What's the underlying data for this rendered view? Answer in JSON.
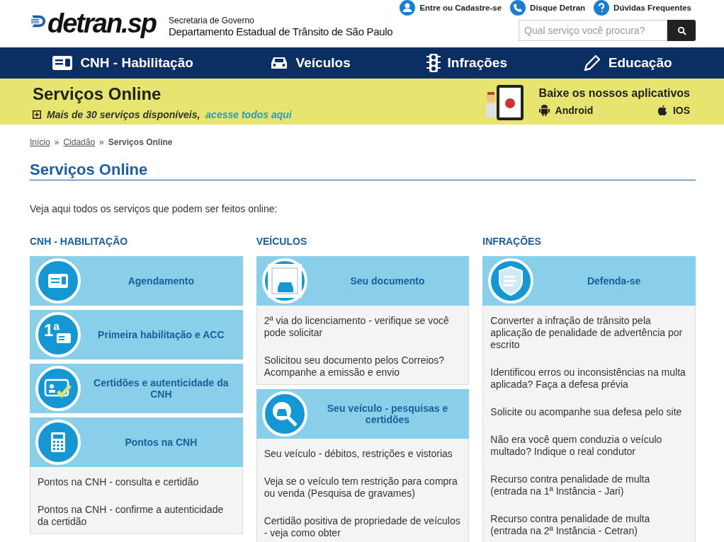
{
  "header": {
    "logo_text": "detran.sp",
    "org_line1": "Secretaria de Governo",
    "org_line2": "Departamento Estadual de Trânsito de São Paulo",
    "top_links": [
      {
        "kind": "user",
        "label": "Entre ou Cadastre-se"
      },
      {
        "kind": "phone",
        "label": "Disque Detran"
      },
      {
        "kind": "help",
        "label": "Dúvidas Frequentes"
      }
    ],
    "search": {
      "placeholder": "Qual serviço você procura?"
    }
  },
  "nav": [
    {
      "kind": "license",
      "label": "CNH - Habilitação"
    },
    {
      "kind": "car",
      "label": "Veículos"
    },
    {
      "kind": "traffic-light",
      "label": "Infrações"
    },
    {
      "kind": "pencil",
      "label": "Educação"
    }
  ],
  "banner": {
    "title": "Serviços Online",
    "lead": "Mais de 30 serviços disponíveis,",
    "link": "acesse todos aqui",
    "apps_title": "Baixe os nossos aplicativos",
    "apps": [
      {
        "kind": "android",
        "label": "Android"
      },
      {
        "kind": "apple",
        "label": "IOS"
      }
    ]
  },
  "breadcrumb": [
    {
      "label": "Início",
      "current": false
    },
    {
      "label": "Cidadão",
      "current": false
    },
    {
      "label": "Serviços Online",
      "current": true
    }
  ],
  "breadcrumb_separator": "»",
  "page_title": "Serviços Online",
  "intro": "Veja aqui todos os serviços que podem ser feitos online:",
  "columns": [
    {
      "heading": "CNH - HABILITAÇÃO",
      "cards": [
        {
          "kind": "license",
          "title": "Agendamento"
        },
        {
          "kind": "first",
          "title": "Primeira habilitação e ACC",
          "badge": "1ª"
        },
        {
          "kind": "certificate",
          "title": "Certidões e autenticidade da CNH"
        },
        {
          "kind": "calculator",
          "title": "Pontos na CNH",
          "links": [
            "Pontos na CNH - consulta e certidão",
            "Pontos na CNH - confirme a autenticidade da certidão"
          ]
        }
      ]
    },
    {
      "heading": "VEÍCULOS",
      "cards": [
        {
          "kind": "document",
          "title": "Seu documento",
          "links": [
            "2ª via do licenciamento - verifique se você pode solicitar",
            "Solicitou seu documento pelos Correios? Acompanhe a emissão e envio"
          ]
        },
        {
          "kind": "search-car",
          "title": "Seu veículo - pesquisas e certidões",
          "links": [
            "Seu veículo - débitos, restrições e vistorias",
            "Veja se o veículo tem restrição para compra ou venda (Pesquisa de gravames)",
            "Certidão positiva de propriedade de veículos - veja como obter"
          ]
        }
      ]
    },
    {
      "heading": "INFRAÇÕES",
      "cards": [
        {
          "kind": "shield",
          "title": "Defenda-se",
          "links": [
            "Converter a infração de trânsito pela aplicação de penalidade de advertência por escrito",
            "Identificou erros ou inconsistências na multa aplicada? Faça a defesa prévia",
            "Solicite ou acompanhe sua defesa pelo site",
            "Não era você quem conduzia o veículo multado? Indique o real condutor",
            "Recurso contra penalidade de multa (entrada na 1ª Instância - Jari)",
            "Recurso contra penalidade de multa (entrada na 2ª Instância - Cetran)"
          ]
        }
      ]
    }
  ]
}
